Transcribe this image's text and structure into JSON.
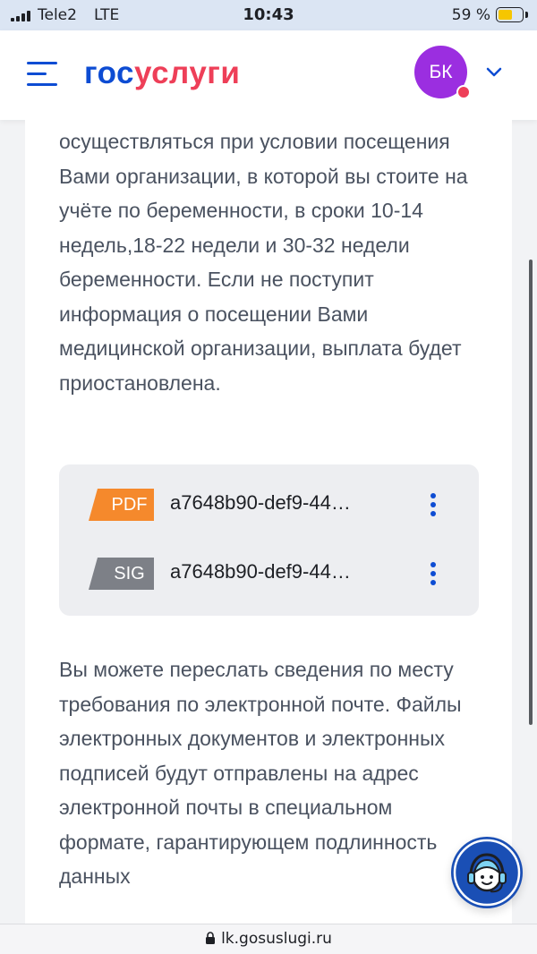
{
  "status_bar": {
    "carrier": "Tele2",
    "network": "LTE",
    "time": "10:43",
    "battery_percent": "59 %",
    "battery_level": 0.59
  },
  "header": {
    "logo_part_a": "гос",
    "logo_part_b": "услуги",
    "avatar_initials": "БК",
    "icons": {
      "menu": "hamburger-menu-icon",
      "expand": "chevron-down-icon",
      "notification": "notification-dot"
    }
  },
  "content": {
    "paragraph_top": "осуществляться при условии посещения Вами организации, в которой вы стоите на учёте по беременности, в сроки 10-14 недель,18-22 недели и 30-32 недели беременности. Если не поступит информация о посещении Вами медицинской организации, выплата будет приостановлена.",
    "files": [
      {
        "type": "PDF",
        "name": "a7648b90-def9-44…",
        "color": "#f5892c"
      },
      {
        "type": "SIG",
        "name": "a7648b90-def9-44…",
        "color": "#7d8087"
      }
    ],
    "paragraph_bottom": "Вы можете переслать сведения по месту требования по электронной почте. Файлы электронных документов и электронных подписей будут отправлены на адрес электронной почты в специальном формате, гарантирующем подлинность данных"
  },
  "support": {
    "icon": "support-operator-icon"
  },
  "url_bar": {
    "url": "lk.gosuslugi.ru",
    "icon": "lock-icon"
  },
  "colors": {
    "brand_blue": "#0d4cd3",
    "brand_red": "#ee3f58",
    "avatar_purple": "#9b2ee0",
    "text": "#4a5260"
  }
}
